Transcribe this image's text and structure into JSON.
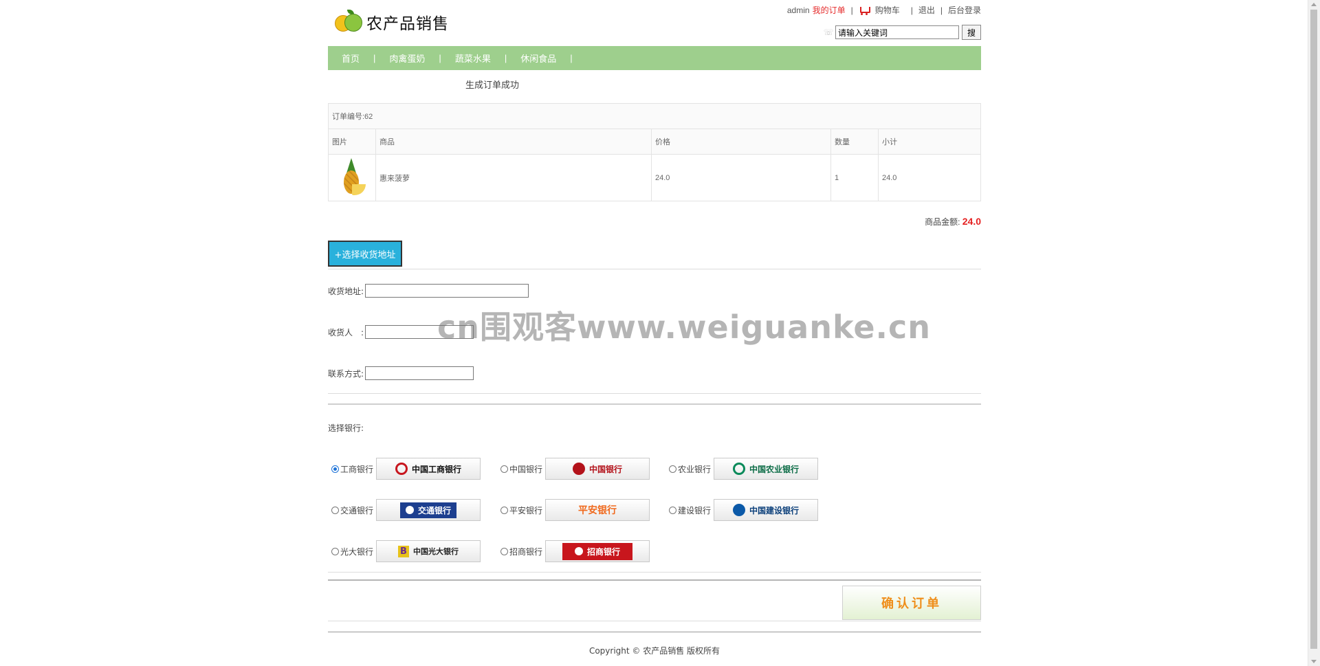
{
  "header": {
    "site_title": "农产品销售",
    "username": "admin",
    "my_orders": "我的订单",
    "cart": "购物车",
    "logout": "退出",
    "admin_login": "后台登录",
    "sep": "|",
    "search_value": "请输入关键词",
    "search_button": "搜"
  },
  "nav": {
    "items": [
      "首页",
      "肉禽蛋奶",
      "蔬菜水果",
      "休闲食品"
    ],
    "sep": "|"
  },
  "order": {
    "success_message": "生成订单成功",
    "order_number_label": "订单编号:62",
    "columns": [
      "图片",
      "商品",
      "价格",
      "数量",
      "小计"
    ],
    "rows": [
      {
        "product": "惠来菠萝",
        "price": "24.0",
        "quantity": "1",
        "subtotal": "24.0"
      }
    ],
    "total_label": "商品金额:",
    "total_value": "24.0"
  },
  "address": {
    "choose_button": "+选择收货地址",
    "address_label": "收货地址:",
    "receiver_label": "收货人　:",
    "phone_label": "联系方式:",
    "address_value": "",
    "receiver_value": "",
    "phone_value": ""
  },
  "payment": {
    "choose_bank_label": "选择银行:",
    "selected": "工商银行",
    "banks": [
      {
        "label": "工商银行",
        "logo_text": "中国工商银行",
        "color": "#c7161e"
      },
      {
        "label": "中国银行",
        "logo_text": "中国银行",
        "color": "#b3121a"
      },
      {
        "label": "农业银行",
        "logo_text": "中国农业银行",
        "color": "#0a8a5a"
      },
      {
        "label": "交通银行",
        "logo_text": "交通银行",
        "color": "#1d3f8f"
      },
      {
        "label": "平安银行",
        "logo_text": "平安银行",
        "color": "#f06a1e"
      },
      {
        "label": "建设银行",
        "logo_text": "中国建设银行",
        "color": "#0b59a8"
      },
      {
        "label": "光大银行",
        "logo_text": "中国光大银行",
        "color": "#6a2c8c"
      },
      {
        "label": "招商银行",
        "logo_text": "招商银行",
        "color": "#c8161d"
      }
    ]
  },
  "confirm_button": "确认订单",
  "footer": "Copyright © 农产品销售 版权所有",
  "watermark": "cn围观客www.weiguanke.cn"
}
